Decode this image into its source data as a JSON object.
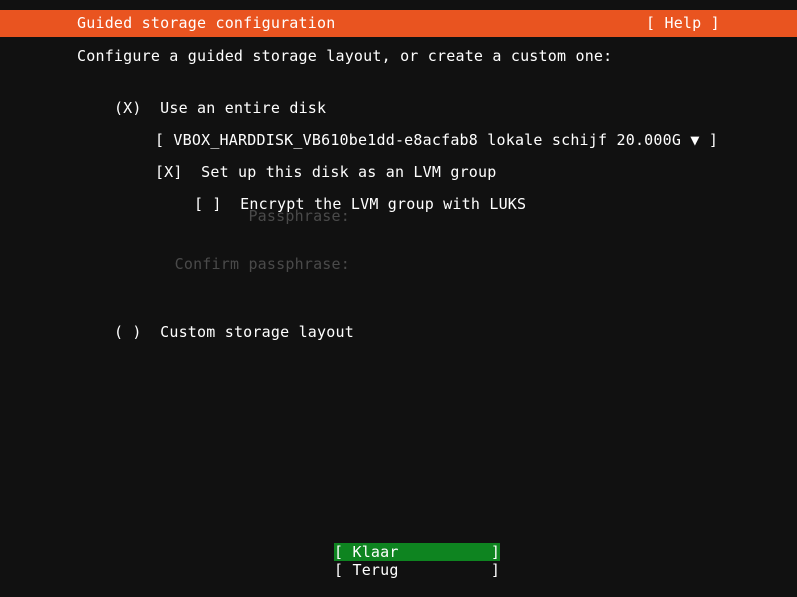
{
  "header": {
    "title": "Guided storage configuration",
    "help_label": "[ Help ]"
  },
  "main": {
    "instruction": "Configure a guided storage layout, or create a custom one:",
    "options": [
      {
        "marker": "(X)",
        "label": "Use an entire disk",
        "selected": true
      },
      {
        "marker": "( )",
        "label": "Custom storage layout",
        "selected": false
      }
    ],
    "disk_selector": {
      "open_bracket": "[",
      "value": "VBOX_HARDDISK_VB610be1dd-e8acfab8 lokale schijf 20.000G",
      "arrow": "▼",
      "close_bracket": "]"
    },
    "lvm_checkbox": {
      "marker": "[X]",
      "label": "Set up this disk as an LVM group",
      "checked": true
    },
    "luks_checkbox": {
      "marker": "[ ]",
      "label": "Encrypt the LVM group with LUKS",
      "checked": false
    },
    "passphrase_label": "Passphrase:",
    "confirm_passphrase_label": "Confirm passphrase:",
    "passphrase_value": "",
    "confirm_passphrase_value": ""
  },
  "footer": {
    "done_label": "[ Klaar          ]",
    "back_label": "[ Terug          ]"
  },
  "colors": {
    "accent_orange": "#e95420",
    "selection_green": "#0e8420",
    "background": "#111111",
    "foreground": "#ffffff",
    "disabled": "#4a4a4a"
  }
}
